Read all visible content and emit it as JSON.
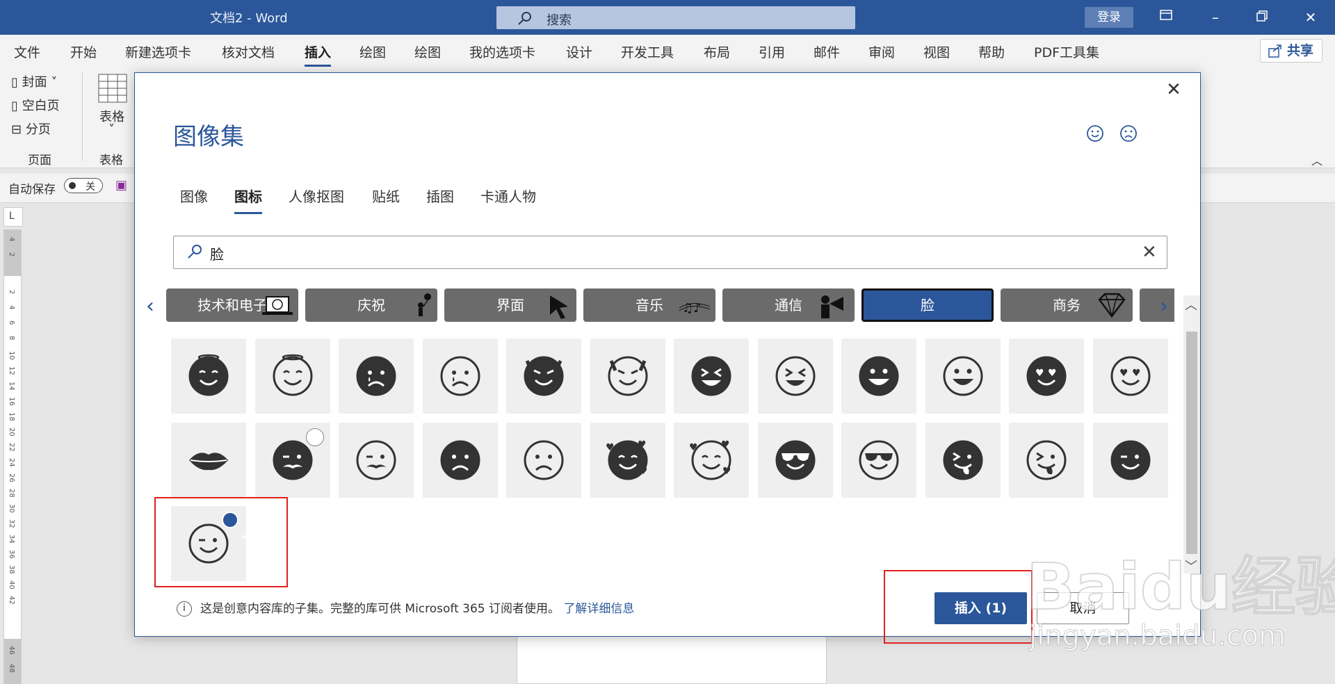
{
  "titlebar": {
    "doc_title": "文档2 - Word",
    "search_placeholder": "搜索",
    "login": "登录"
  },
  "menu": {
    "tabs": [
      "文件",
      "开始",
      "新建选项卡",
      "核对文档",
      "插入",
      "绘图",
      "绘图",
      "我的选项卡",
      "设计",
      "开发工具",
      "布局",
      "引用",
      "邮件",
      "审阅",
      "视图",
      "帮助",
      "PDF工具集"
    ],
    "active_index": 4,
    "share": "共享"
  },
  "ribbon": {
    "cover": "封面",
    "blank": "空白页",
    "break": "分页",
    "group_page": "页面",
    "table": "表格",
    "group_table": "表格"
  },
  "qat": {
    "autosave": "自动保存",
    "toggle": "关"
  },
  "ruler": {
    "top_numbers": [
      "4",
      "2"
    ],
    "numbers": [
      "2",
      "4",
      "6",
      "8",
      "10",
      "12",
      "14",
      "16",
      "18",
      "20",
      "22",
      "24",
      "26",
      "28",
      "30",
      "32",
      "34",
      "36",
      "38",
      "40",
      "42"
    ],
    "bottom_numbers": [
      "46",
      "48"
    ]
  },
  "dialog": {
    "title": "图像集",
    "tabs": [
      "图像",
      "图标",
      "人像抠图",
      "贴纸",
      "插图",
      "卡通人物"
    ],
    "active_tab": 1,
    "search_value": "脸",
    "categories": [
      "技术和电子",
      "庆祝",
      "界面",
      "音乐",
      "通信",
      "脸",
      "商务"
    ],
    "selected_category": 5,
    "note": "这是创意内容库的子集。完整的库可供 Microsoft 365 订阅者使用。",
    "link": "了解详细信息",
    "insert": "插入 (1)",
    "cancel": "取消",
    "icons": [
      "angel-face-filled",
      "angel-face-outline",
      "sad-tear-face-filled",
      "sad-tear-face-outline",
      "devil-face-filled",
      "devil-face-outline",
      "laughing-face-filled",
      "laughing-face-outline",
      "grinning-face-filled",
      "grinning-face-outline",
      "heart-eyes-face-filled",
      "heart-eyes-face-outline",
      "lips",
      "mustache-face-filled",
      "mustache-face-outline",
      "frowning-face-filled",
      "frowning-face-outline",
      "love-hearts-face-filled",
      "love-hearts-face-outline",
      "sunglasses-face-filled",
      "sunglasses-face-outline",
      "tongue-wink-face-filled",
      "tongue-wink-face-outline",
      "neutral-smile-face-filled",
      "wink-face-outline"
    ],
    "selected_icon": 24
  },
  "watermark": {
    "brand": "Baidu经验",
    "url": "jingyan.baidu.com"
  }
}
